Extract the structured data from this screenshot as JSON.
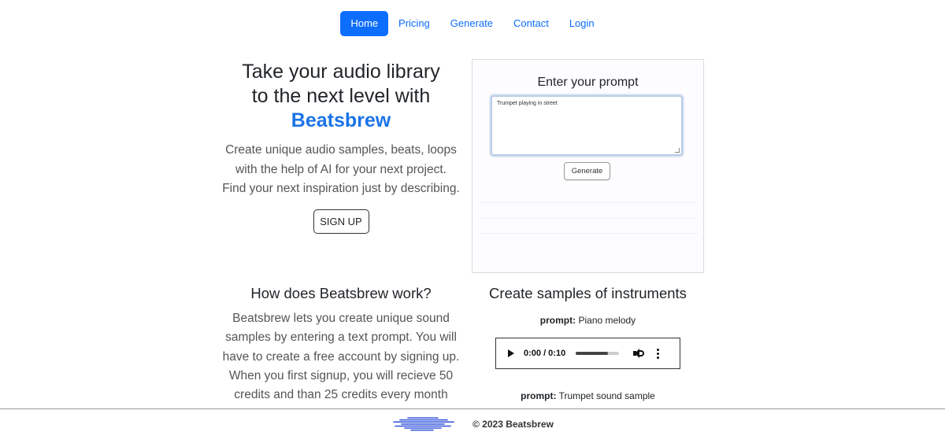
{
  "nav": {
    "items": [
      {
        "label": "Home",
        "active": true
      },
      {
        "label": "Pricing",
        "active": false
      },
      {
        "label": "Generate",
        "active": false
      },
      {
        "label": "Contact",
        "active": false
      },
      {
        "label": "Login",
        "active": false
      }
    ]
  },
  "hero": {
    "title_line1": "Take your audio library",
    "title_line2": "to the next level with",
    "brand": "Beatsbrew",
    "subtitle": "Create unique audio samples, beats, loops with the help of AI for your next project. Find your next inspiration just by describing.",
    "signup_label": "SIGN UP"
  },
  "prompt_card": {
    "title": "Enter your prompt",
    "textarea_value": "Trumpet playing in street",
    "generate_label": "Generate"
  },
  "how": {
    "title": "How does Beatsbrew work?",
    "text": "Beatsbrew lets you create unique sound samples by entering a text prompt. You will have to create a free account by signing up. When you first signup, you will recieve 50 credits and than 25 credits every month"
  },
  "samples": {
    "title": "Create samples of instruments",
    "items": [
      {
        "prompt_label": "prompt:",
        "prompt_text": "Piano melody",
        "time": "0:00 / 0:10",
        "progress": 0.75
      },
      {
        "prompt_label": "prompt:",
        "prompt_text": "Trumpet sound sample"
      }
    ]
  },
  "footer": {
    "copyright": "© 2023 Beatsbrew",
    "logo_icon": "beatsbrew-wave-logo",
    "logo_color": "#3b5bdb"
  },
  "colors": {
    "accent": "#0d6efd",
    "brand": "#1a73e8"
  }
}
